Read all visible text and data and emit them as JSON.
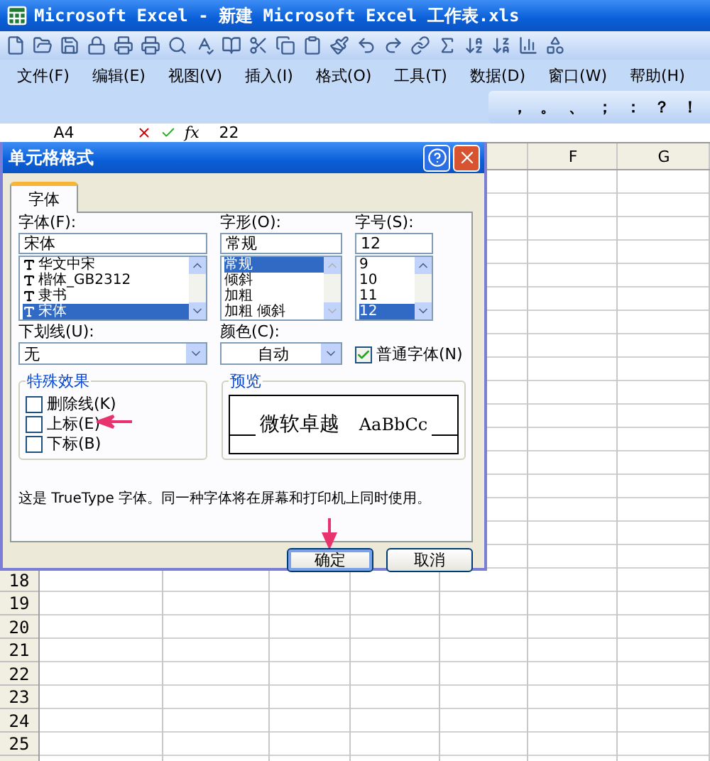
{
  "window": {
    "title": "Microsoft Excel - 新建 Microsoft Excel 工作表.xls"
  },
  "menu": [
    "文件(F)",
    "编辑(E)",
    "视图(V)",
    "插入(I)",
    "格式(O)",
    "工具(T)",
    "数据(D)",
    "窗口(W)",
    "帮助(H)"
  ],
  "punctuation_toolbar": [
    "，",
    "。",
    "、",
    "；",
    "：",
    "？",
    "！"
  ],
  "formula_bar": {
    "name_box": "A4",
    "function_label": "fx",
    "value": "22"
  },
  "sheet": {
    "column_headers": [
      "F",
      "G"
    ],
    "row_headers": [
      "18",
      "19",
      "20",
      "21",
      "22",
      "23",
      "24",
      "25"
    ]
  },
  "dialog": {
    "title": "单元格格式",
    "tabs": [
      {
        "label": "字体",
        "selected": true
      }
    ],
    "font": {
      "label": "字体(F):",
      "value": "宋体",
      "options": [
        {
          "label": "华文中宋",
          "selected": false
        },
        {
          "label": "楷体_GB2312",
          "selected": false
        },
        {
          "label": "隶书",
          "selected": false
        },
        {
          "label": "宋体",
          "selected": true
        }
      ]
    },
    "style": {
      "label": "字形(O):",
      "value": "常规",
      "options": [
        {
          "label": "常规",
          "selected": true
        },
        {
          "label": "倾斜",
          "selected": false
        },
        {
          "label": "加粗",
          "selected": false
        },
        {
          "label": "加粗 倾斜",
          "selected": false
        }
      ]
    },
    "size": {
      "label": "字号(S):",
      "value": "12",
      "options": [
        {
          "label": "9",
          "selected": false
        },
        {
          "label": "10",
          "selected": false
        },
        {
          "label": "11",
          "selected": false
        },
        {
          "label": "12",
          "selected": true
        }
      ]
    },
    "underline": {
      "label": "下划线(U):",
      "value": "无"
    },
    "color": {
      "label": "颜色(C):",
      "value": "自动"
    },
    "normal_font": {
      "label": "普通字体(N)",
      "checked": true
    },
    "effects": {
      "title": "特殊效果",
      "items": [
        {
          "label": "删除线(K)",
          "checked": false
        },
        {
          "label": "上标(E)",
          "checked": false
        },
        {
          "label": "下标(B)",
          "checked": false
        }
      ]
    },
    "preview": {
      "title": "预览",
      "sample_cjk": "微软卓越",
      "sample_latin": "AaBbCc"
    },
    "note": "这是 TrueType 字体。同一种字体将在屏幕和打印机上同时使用。",
    "buttons": [
      {
        "label": "确定",
        "default": true
      },
      {
        "label": "取消",
        "default": false
      }
    ]
  }
}
